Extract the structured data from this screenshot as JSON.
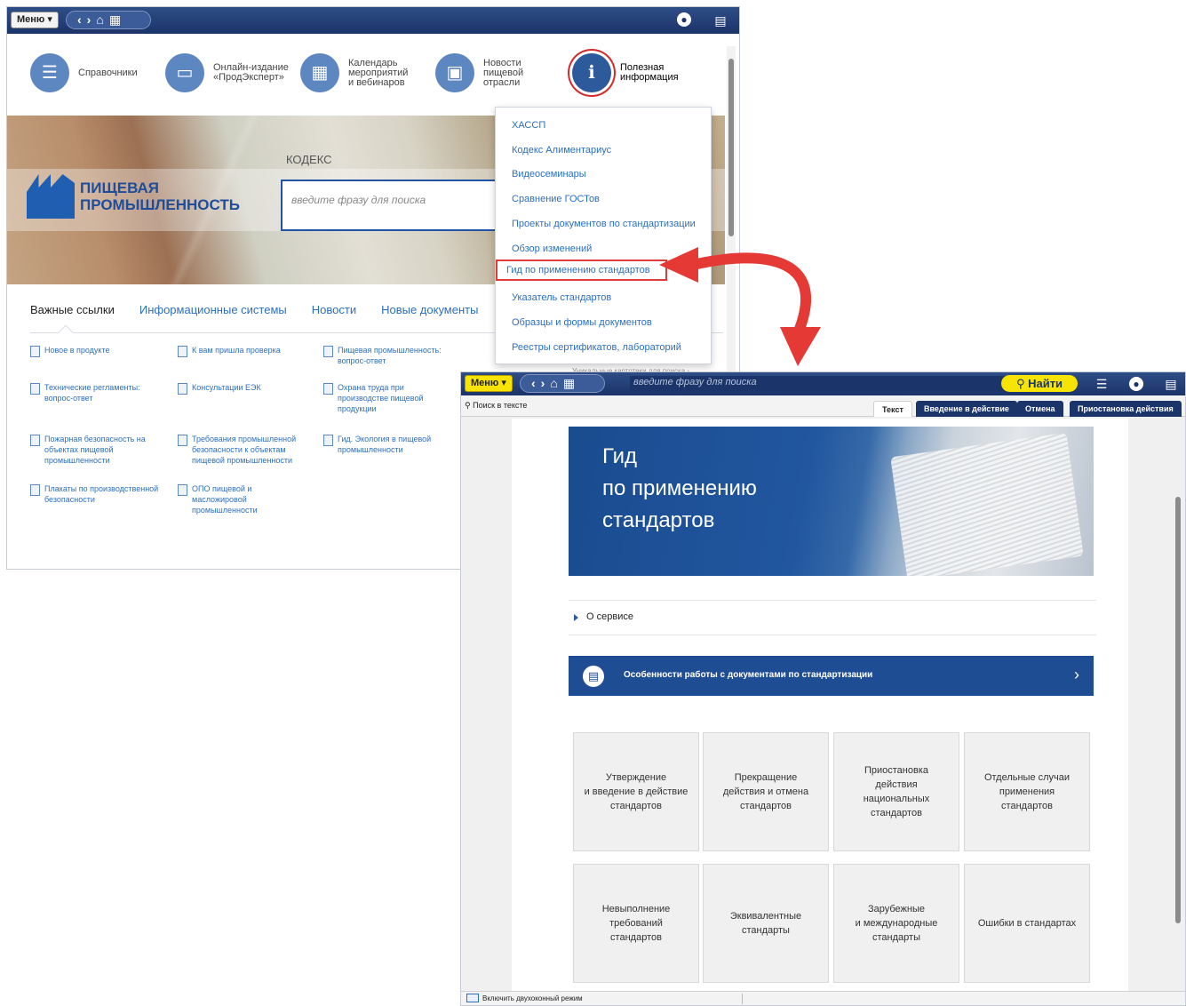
{
  "window1": {
    "menu_label": "Меню ▾",
    "nav_icons": [
      "back-icon",
      "forward-icon",
      "home-icon",
      "grid-icon"
    ],
    "tiles": [
      {
        "label": "Справочники",
        "icon": "list-icon"
      },
      {
        "label": "Онлайн-издание\n«ПродЭксперт»",
        "icon": "monitor-icon"
      },
      {
        "label": "Календарь\nмероприятий\nи вебинаров",
        "icon": "calendar-icon"
      },
      {
        "label": "Новости\nпищевой\nотрасли",
        "icon": "news-icon"
      },
      {
        "label": "Полезная\nинформация",
        "icon": "info-icon"
      }
    ],
    "brand_text": "ПИЩЕВАЯ\nПРОМЫШЛЕННОСТЬ",
    "kodeks_logo": "КОДЕКС",
    "search_placeholder": "введите фразу для поиска",
    "link_tabs": [
      "Важные ссылки",
      "Информационные системы",
      "Новости",
      "Новые документы"
    ],
    "links": [
      "Новое в продукте",
      "К вам пришла проверка",
      "Пищевая промышленность:\nвопрос-ответ",
      "Технические регламенты:\nвопрос-ответ",
      "Консультации ЕЭК",
      "Охрана труда при\nпроизводстве пищевой\nпродукции",
      "Пожарная безопасность на\nобъектах пищевой\nпромышленности",
      "Требования промышленной\nбезопасности к объектам\nпищевой промышленности",
      "Гид. Экология в пищевой\nпромышленности",
      "Плакаты по производственной\nбезопасности",
      "ОПО пищевой и\nмасложировой\nпромышленности"
    ],
    "dropdown_items": [
      "ХАССП",
      "Кодекс Алиментариус",
      "Видеосеминары",
      "Сравнение ГОСТов",
      "Проекты документов по стандартизации",
      "Обзор изменений",
      "Гид по применению стандартов",
      "Указатель стандартов",
      "Образцы и формы документов",
      "Реестры сертификатов, лабораторий"
    ],
    "highlighted_item_index": 6,
    "hint_text": "Уникальные картотеки для поиска  ›"
  },
  "window2": {
    "menu_label": "Меню ▾",
    "search_placeholder": "введите фразу для поиска",
    "find_button": "Найти",
    "search_in_text": "Поиск в тексте",
    "tabs": [
      "Текст",
      "Введение в действие",
      "Отмена",
      "Приостановка действия"
    ],
    "active_tab": "Текст",
    "banner_title": "Гид\nпо применению\nстандартов",
    "accordion_label": "О сервисе",
    "feature_label": "Особенности работы с документами по стандартизации",
    "cards": [
      "Утверждение\nи введение в действие\nстандартов",
      "Прекращение\nдействия и отмена\nстандартов",
      "Приостановка\nдействия\nнациональных\nстандартов",
      "Отдельные случаи\nприменения\nстандартов",
      "Невыполнение\nтребований\nстандартов",
      "Эквивалентные\nстандарты",
      "Зарубежные\nи международные\nстандарты",
      "Ошибки в стандартах"
    ],
    "status_text": "Включить двухоконный режим"
  },
  "colors": {
    "topbar": "#1b346a",
    "accent": "#2c6fbf",
    "menu_yellow": "#f7e400",
    "highlight_red": "#e03b3b",
    "feature_blue": "#1f4d94"
  }
}
